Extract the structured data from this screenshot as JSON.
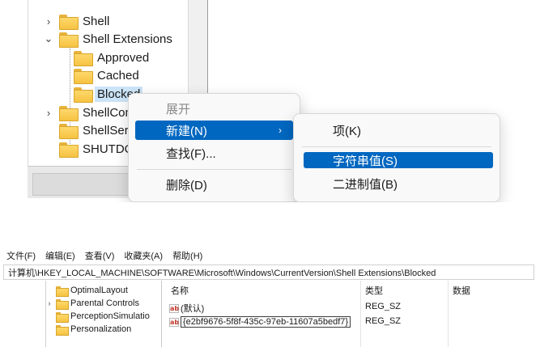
{
  "zoom_tree": {
    "items": [
      {
        "label": "Shell",
        "expander": "›"
      },
      {
        "label": "Shell Extensions",
        "expander": "⌄"
      },
      {
        "label": "Approved",
        "expander": ""
      },
      {
        "label": "Cached",
        "expander": ""
      },
      {
        "label": "Blocked",
        "expander": ""
      },
      {
        "label": "ShellCom",
        "expander": "›"
      },
      {
        "label": "ShellServ",
        "expander": ""
      },
      {
        "label": "SHUTDOW",
        "expander": ""
      }
    ]
  },
  "context_menu": {
    "expand": "展开",
    "new": "新建(N)",
    "new_arrow": "›",
    "find": "查找(F)...",
    "delete": "删除(D)"
  },
  "submenu": {
    "key": "项(K)",
    "string_value": "字符串值(S)",
    "binary_value": "二进制值(B)"
  },
  "menubar": {
    "file": "文件(F)",
    "edit": "编辑(E)",
    "view": "查看(V)",
    "favorites": "收藏夹(A)",
    "help": "帮助(H)"
  },
  "address": "计算机\\HKEY_LOCAL_MACHINE\\SOFTWARE\\Microsoft\\Windows\\CurrentVersion\\Shell Extensions\\Blocked",
  "small_tree": {
    "items": [
      {
        "label": "OptimalLayout",
        "expander": ""
      },
      {
        "label": "Parental Controls",
        "expander": "›"
      },
      {
        "label": "PerceptionSimulatio",
        "expander": ""
      },
      {
        "label": "Personalization",
        "expander": ""
      }
    ]
  },
  "list": {
    "headers": {
      "name": "名称",
      "type": "类型",
      "data": "数据"
    },
    "rows": [
      {
        "icon": "ab",
        "name": "(默认)",
        "type": "REG_SZ",
        "data": ""
      },
      {
        "icon": "ab",
        "name": "{e2bf9676-5f8f-435c-97eb-11607a5bedf7}",
        "type": "REG_SZ",
        "data": ""
      }
    ]
  },
  "colors": {
    "menu_highlight": "#0067c0",
    "tree_selection": "#cce4f7",
    "folder": "#f5c342"
  }
}
